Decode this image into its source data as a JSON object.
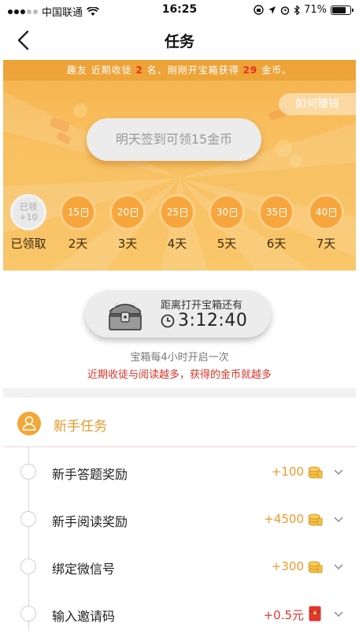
{
  "status_bar": {
    "carrier": "中国联通",
    "time": "16:25",
    "battery": "71%"
  },
  "nav": {
    "title": "任务"
  },
  "ticker": {
    "prefix": "趣友 近期收徒",
    "count": "2",
    "middle": "名、刚刚开宝箱获得",
    "coins": "29",
    "suffix": "金币。"
  },
  "howto_label": "如何赚钱",
  "signin_label": "明天签到可领15金币",
  "days": [
    {
      "line1": "已领",
      "line2": "+10",
      "label": "已领取",
      "done": true
    },
    {
      "amount": "15",
      "label": "2天",
      "done": false
    },
    {
      "amount": "20",
      "label": "3天",
      "done": false
    },
    {
      "amount": "25",
      "label": "4天",
      "done": false
    },
    {
      "amount": "30",
      "label": "5天",
      "done": false
    },
    {
      "amount": "35",
      "label": "6天",
      "done": false
    },
    {
      "amount": "40",
      "label": "7天",
      "done": false
    }
  ],
  "chest": {
    "title": "距离打开宝箱还有",
    "timer": "3:12:40",
    "note1": "宝箱每4小时开启一次",
    "note2": "近期收徒与阅读越多，获得的金币就越多"
  },
  "section": {
    "title": "新手任务"
  },
  "tasks": [
    {
      "name": "新手答题奖励",
      "reward": "+100",
      "icon": "coins-icon"
    },
    {
      "name": "新手阅读奖励",
      "reward": "+4500",
      "icon": "coins-icon"
    },
    {
      "name": "绑定微信号",
      "reward": "+300",
      "icon": "coins-icon"
    },
    {
      "name": "输入邀请码",
      "reward": "+0.5元",
      "icon": "red-envelope-icon"
    }
  ],
  "colors": {
    "accent": "#f3a737",
    "reward": "#ec9a2f",
    "alert": "#e0372f"
  }
}
